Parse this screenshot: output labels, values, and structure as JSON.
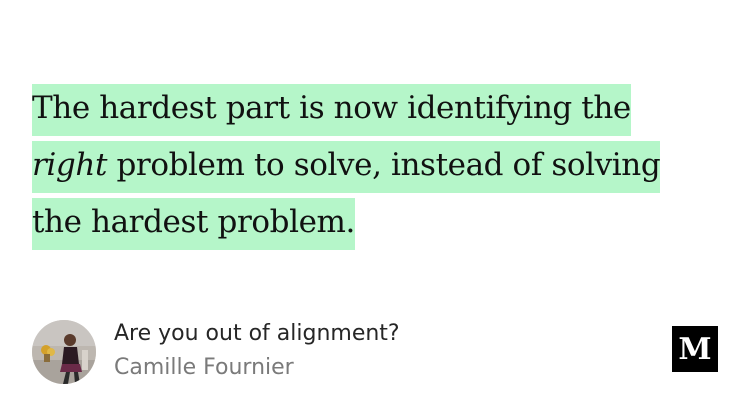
{
  "quote": {
    "line1": "The hardest part is now identifying the",
    "emphasis": "right",
    "line2_rest": " problem to solve, instead of solving",
    "line3": "the hardest problem.",
    "highlight_color": "#b5f6c9"
  },
  "article": {
    "title": "Are you out of alignment?",
    "author": "Camille Fournier"
  },
  "logo": {
    "letter": "M",
    "icon": "medium-logo-icon"
  },
  "avatar": {
    "icon": "author-avatar-photo"
  }
}
